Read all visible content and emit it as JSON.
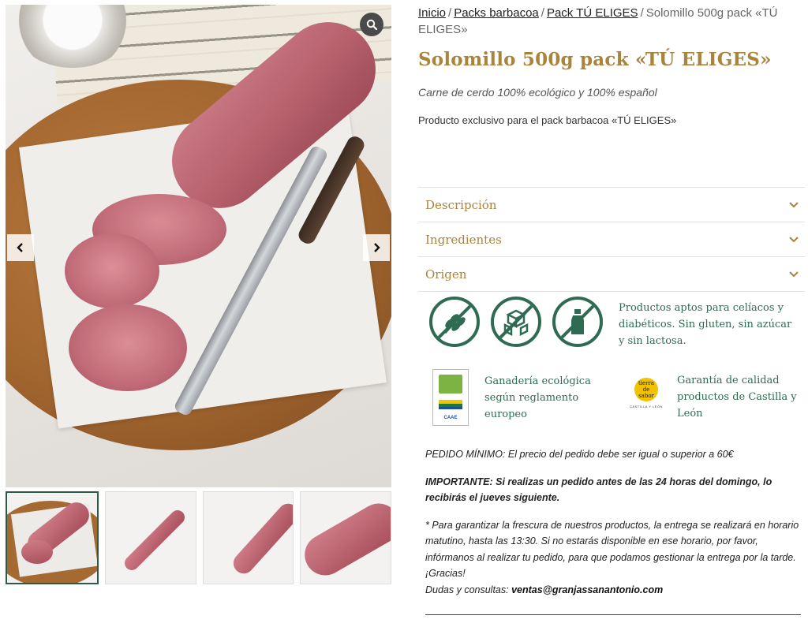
{
  "gallery": {
    "zoom_icon": "magnifier-icon",
    "prev_icon": "chevron-left-icon",
    "next_icon": "chevron-right-icon",
    "thumbnail_count": 4
  },
  "breadcrumb": {
    "items": [
      "Inicio",
      "Packs barbacoa",
      "Pack TÚ ELIGES"
    ],
    "current": "Solomillo 500g pack «TÚ ELIGES»",
    "separator": "/"
  },
  "product": {
    "title": "Solomillo 500g pack «TÚ ELIGES»",
    "subtitle": "Carne de cerdo 100% ecológico y 100% español",
    "exclusive_note": "Producto exclusivo para el pack barbacoa «TÚ ELIGES»"
  },
  "accordion": {
    "items": [
      {
        "label": "Descripción"
      },
      {
        "label": "Ingredientes"
      },
      {
        "label": "Origen"
      }
    ],
    "chevron_icon": "chevron-down-icon"
  },
  "badges": {
    "icons": [
      "gluten-free-icon",
      "sugar-free-icon",
      "lactose-free-icon"
    ],
    "text": "Productos aptos para celíacos y diabéticos. Sin gluten, sin azúcar y sin lactosa."
  },
  "certifications": {
    "eco": {
      "text": "Ganadería ecológica según reglamento europeo",
      "logo_text": "CAAE"
    },
    "quality": {
      "text": "Garantía de calidad productos de Castilla y León",
      "logo_text": "tierra de sabor",
      "logo_sub": "CASTILLA Y LEÓN"
    }
  },
  "info": {
    "minimum_label": "PEDIDO MÍNIMO:",
    "minimum_text": " El precio del pedido debe ser igual o superior a 60€",
    "important_text": "IMPORTANTE: Si realizas un pedido antes de las 24 horas del domingo, lo recibirás el jueves siguiente.",
    "delivery_text": "* Para garantizar la frescura de nuestros productos, la entrega se realizará en horario matutino, hasta las 13:30. Si no estarás disponible en ese horario, por favor, infórmanos al realizar tu pedido, para que podamos gestionar la entrega por la tarde. ¡Gracias!",
    "contact_label": "Dudas y consultas: ",
    "contact_email": "ventas@granjassanantonio.com"
  },
  "colors": {
    "gold": "#a8843c",
    "green": "#2f6b52"
  }
}
